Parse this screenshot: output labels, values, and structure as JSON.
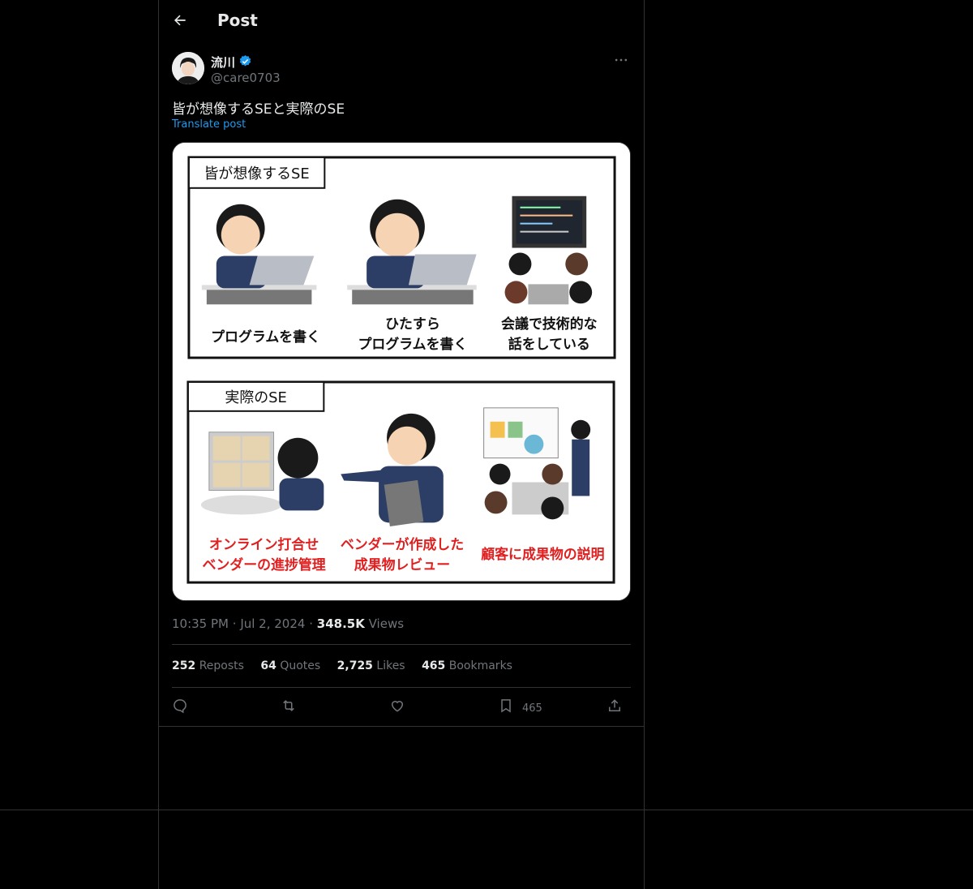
{
  "header": {
    "title": "Post"
  },
  "author": {
    "name": "流川",
    "handle": "@care0703"
  },
  "post": {
    "text": "皆が想像するSEと実際のSE",
    "translate_label": "Translate post"
  },
  "image": {
    "top_panel": {
      "heading": "皆が想像するSE",
      "captions": [
        "プログラムを書く",
        "ひたすら\nプログラムを書く",
        "会議で技術的な\n話をしている"
      ]
    },
    "bottom_panel": {
      "heading": "実際のSE",
      "captions": [
        "オンライン打合せ\nベンダーの進捗管理",
        "ベンダーが作成した\n成果物レビュー",
        "顧客に成果物の説明"
      ]
    }
  },
  "meta": {
    "time": "10:35 PM",
    "date": "Jul 2, 2024",
    "views_count": "348.5K",
    "views_label": "Views"
  },
  "stats": {
    "reposts_count": "252",
    "reposts_label": "Reposts",
    "quotes_count": "64",
    "quotes_label": "Quotes",
    "likes_count": "2,725",
    "likes_label": "Likes",
    "bookmarks_count": "465",
    "bookmarks_label": "Bookmarks"
  },
  "actions": {
    "bookmark_count": "465"
  },
  "colors": {
    "accent": "#1d9bf0",
    "background": "#000000",
    "muted": "#71767b",
    "border": "#2f3336"
  }
}
